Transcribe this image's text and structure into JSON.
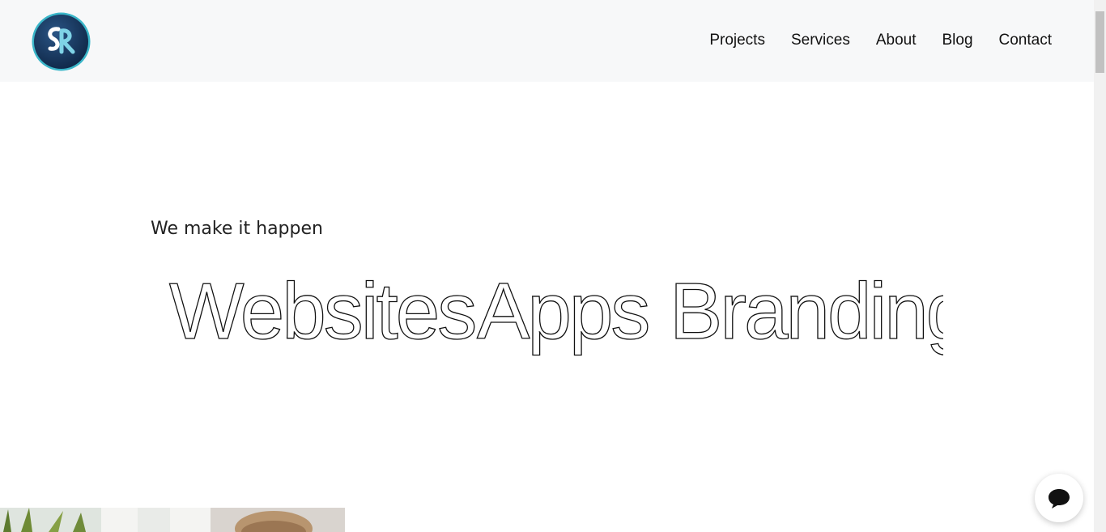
{
  "header": {
    "logo_icon": "sr-monogram-logo",
    "logo_text": "SR",
    "nav": [
      {
        "label": "Projects"
      },
      {
        "label": "Services"
      },
      {
        "label": "About"
      },
      {
        "label": "Blog"
      },
      {
        "label": "Contact"
      }
    ]
  },
  "hero": {
    "subtitle": "We make it happen",
    "words": [
      "Websites",
      "Apps",
      "Branding"
    ]
  },
  "chat": {
    "icon": "chat-bubble-icon"
  },
  "colors": {
    "header_bg": "#f7f8f9",
    "logo_ring": "#3ab6c9",
    "logo_fill": "#14325a",
    "text": "#111111"
  }
}
